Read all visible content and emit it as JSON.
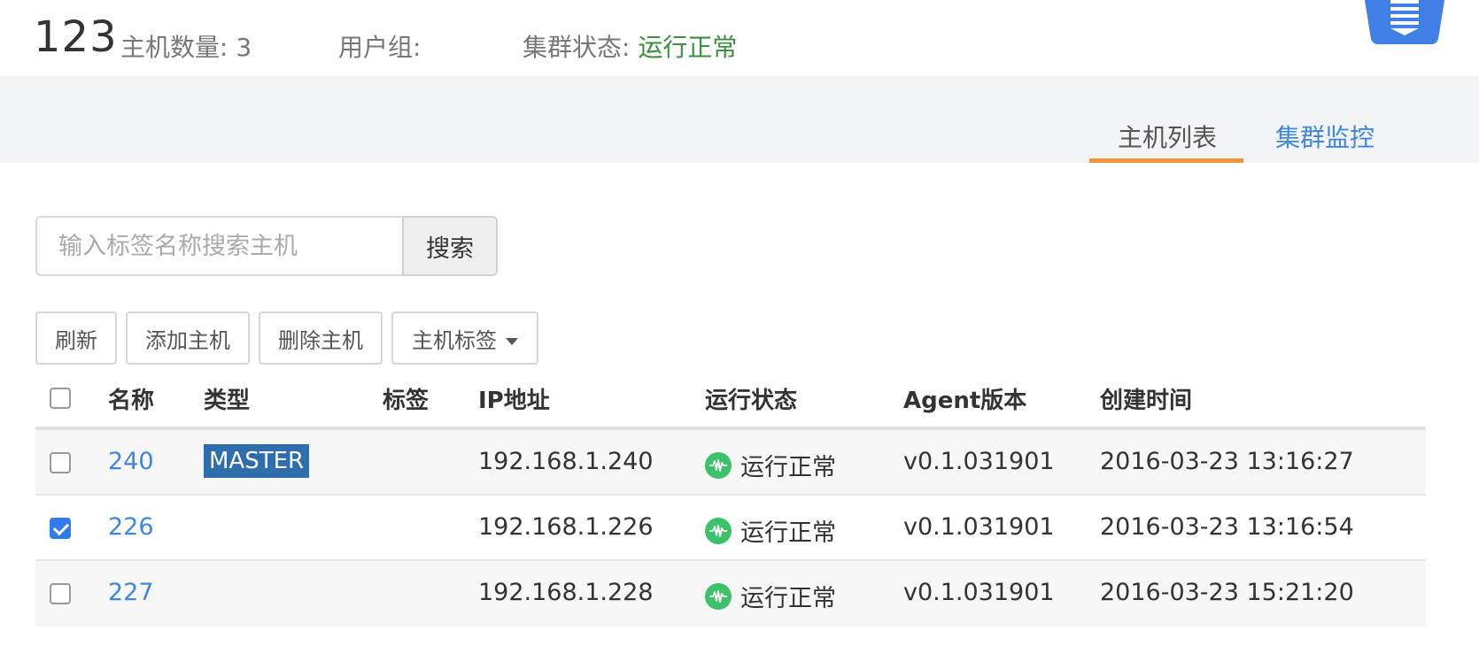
{
  "header": {
    "cluster_name": "123",
    "hosts_label": "主机数量: 3",
    "user_group_label": "用户组:",
    "status_label": "集群状态:",
    "status_value": "运行正常"
  },
  "tabs": [
    {
      "label": "主机列表",
      "active": true
    },
    {
      "label": "集群监控",
      "active": false
    }
  ],
  "search": {
    "placeholder": "输入标签名称搜索主机",
    "button": "搜索"
  },
  "toolbar": {
    "refresh": "刷新",
    "add_host": "添加主机",
    "delete_host": "删除主机",
    "host_tags": "主机标签"
  },
  "table": {
    "columns": [
      "名称",
      "类型",
      "标签",
      "IP地址",
      "运行状态",
      "Agent版本",
      "创建时间"
    ],
    "rows": [
      {
        "checked": false,
        "name": "240",
        "type": "MASTER",
        "tags": "",
        "ip": "192.168.1.240",
        "status": "运行正常",
        "agent": "v0.1.031901",
        "created": "2016-03-23 13:16:27"
      },
      {
        "checked": true,
        "name": "226",
        "type": "",
        "tags": "",
        "ip": "192.168.1.226",
        "status": "运行正常",
        "agent": "v0.1.031901",
        "created": "2016-03-23 13:16:54"
      },
      {
        "checked": false,
        "name": "227",
        "type": "",
        "tags": "",
        "ip": "192.168.1.228",
        "status": "运行正常",
        "agent": "v0.1.031901",
        "created": "2016-03-23 15:21:20"
      }
    ]
  },
  "colors": {
    "accent": "#3f87dd",
    "status_ok": "#3cc36a",
    "tab_underline": "#f0943d",
    "master_badge": "#2e6ead"
  },
  "icons": {
    "status": "pulse-icon",
    "corner": "document-list-icon",
    "dropdown": "caret-down-icon"
  }
}
